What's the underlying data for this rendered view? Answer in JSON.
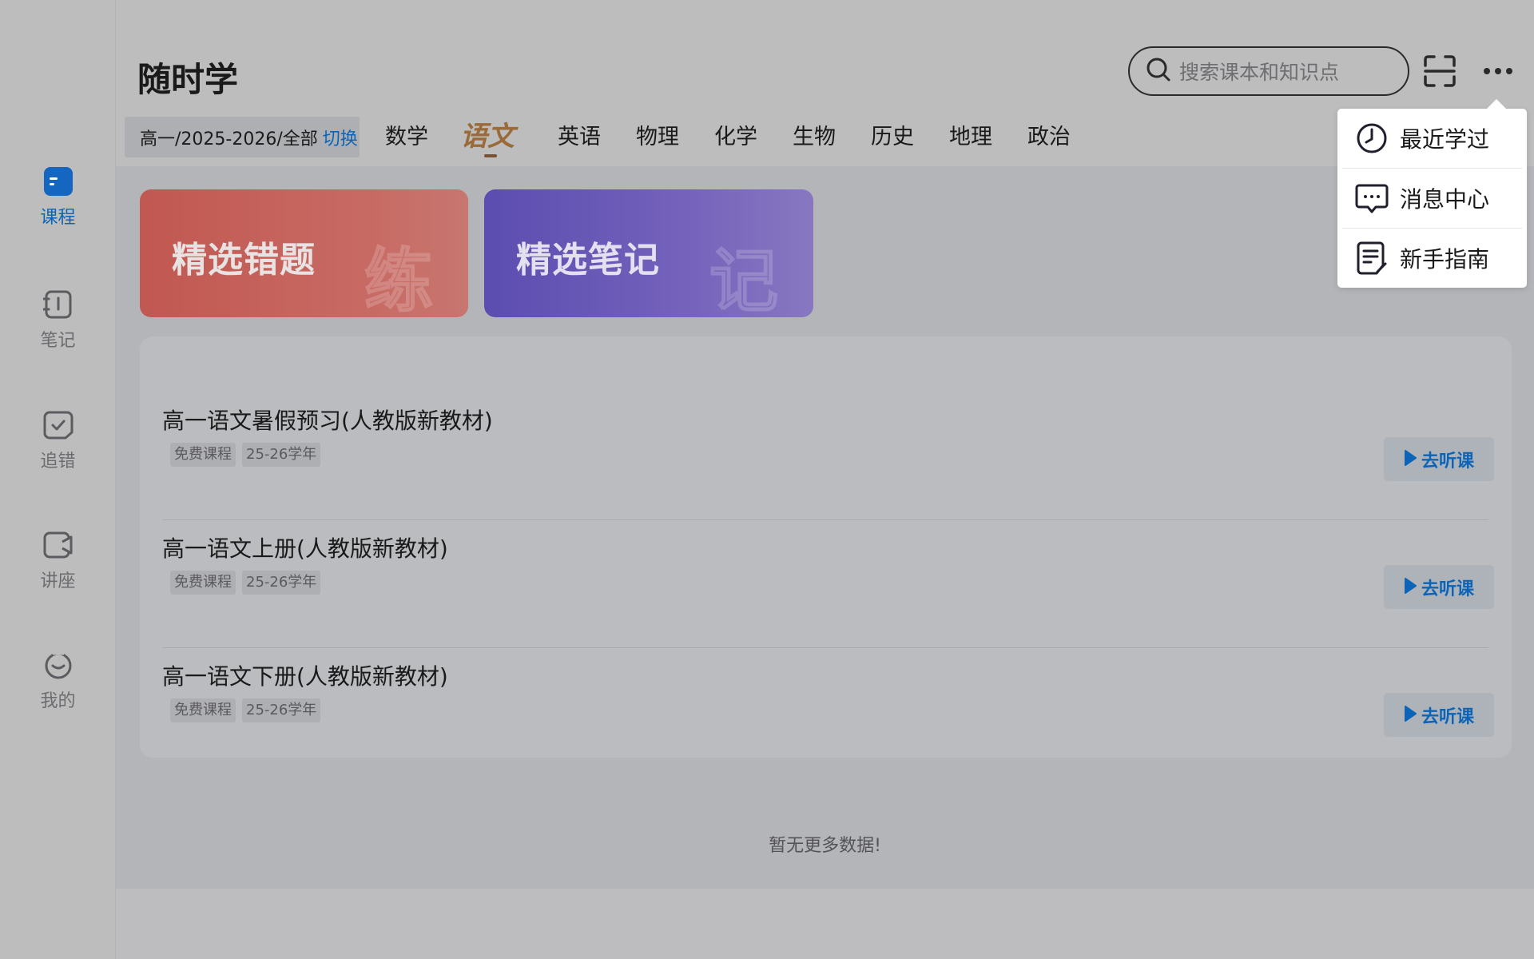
{
  "app": {
    "title": "随时学"
  },
  "sidebar": {
    "items": [
      {
        "label": "课程",
        "icon": "course-icon",
        "active": true
      },
      {
        "label": "笔记",
        "icon": "notebook-icon",
        "active": false
      },
      {
        "label": "追错",
        "icon": "mistake-check-icon",
        "active": false
      },
      {
        "label": "讲座",
        "icon": "lecture-video-icon",
        "active": false
      },
      {
        "label": "我的",
        "icon": "profile-face-icon",
        "active": false
      }
    ]
  },
  "header": {
    "search_placeholder": "搜索课本和知识点",
    "grade_text": "高一/2025-2026/全部",
    "switch_label": "切换"
  },
  "tabs": [
    {
      "label": "数学",
      "active": false
    },
    {
      "label": "语文",
      "active": true
    },
    {
      "label": "英语",
      "active": false
    },
    {
      "label": "物理",
      "active": false
    },
    {
      "label": "化学",
      "active": false
    },
    {
      "label": "生物",
      "active": false
    },
    {
      "label": "历史",
      "active": false
    },
    {
      "label": "地理",
      "active": false
    },
    {
      "label": "政治",
      "active": false
    }
  ],
  "banners": [
    {
      "title": "精选错题",
      "glyph": "练",
      "color": "#c15851"
    },
    {
      "title": "精选笔记",
      "glyph": "记",
      "color": "#5b4db0"
    }
  ],
  "courses": [
    {
      "title": "高一语文暑假预习(人教版新教材)",
      "tags": [
        "免费课程",
        "25-26学年"
      ],
      "button": "去听课"
    },
    {
      "title": "高一语文上册(人教版新教材)",
      "tags": [
        "免费课程",
        "25-26学年"
      ],
      "button": "去听课"
    },
    {
      "title": "高一语文下册(人教版新教材)",
      "tags": [
        "免费课程",
        "25-26学年"
      ],
      "button": "去听课"
    }
  ],
  "footer": {
    "no_more": "暂无更多数据!"
  },
  "dropdown": {
    "items": [
      {
        "label": "最近学过",
        "icon": "clock-icon"
      },
      {
        "label": "消息中心",
        "icon": "message-icon"
      },
      {
        "label": "新手指南",
        "icon": "guide-document-icon"
      }
    ]
  },
  "colors": {
    "accent": "#0b64b8",
    "active_tab": "#9a6a38"
  }
}
